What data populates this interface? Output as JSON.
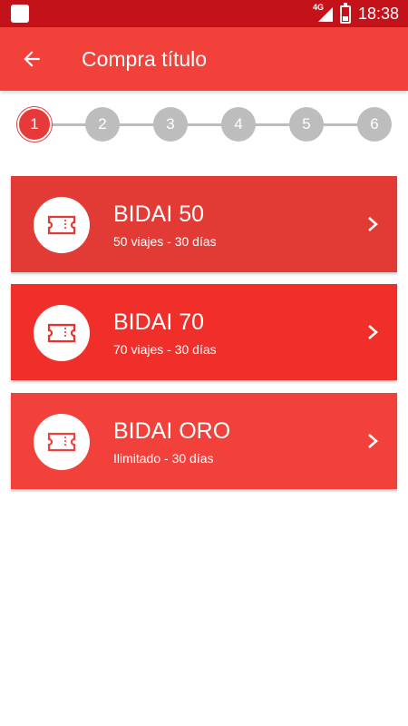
{
  "status_bar": {
    "network": "4G",
    "time": "18:38"
  },
  "app_bar": {
    "title": "Compra título",
    "back_icon": "arrow-left-icon"
  },
  "stepper": {
    "steps": [
      "1",
      "2",
      "3",
      "4",
      "5",
      "6"
    ],
    "active_step": 1
  },
  "colors": {
    "status_bar": "#c4121a",
    "app_bar": "#f2403a",
    "step_active": "#e8393a",
    "step_inactive": "#bdbdbd",
    "card_1": "#e23a34",
    "card_2": "#f02f2a",
    "card_3": "#f2403a"
  },
  "products": [
    {
      "title": "BIDAI 50",
      "subtitle": "50 viajes - 30 días",
      "icon": "ticket-icon"
    },
    {
      "title": "BIDAI 70",
      "subtitle": "70 viajes - 30 días",
      "icon": "ticket-icon"
    },
    {
      "title": "BIDAI ORO",
      "subtitle": "Ilimitado - 30 días",
      "icon": "ticket-icon"
    }
  ]
}
